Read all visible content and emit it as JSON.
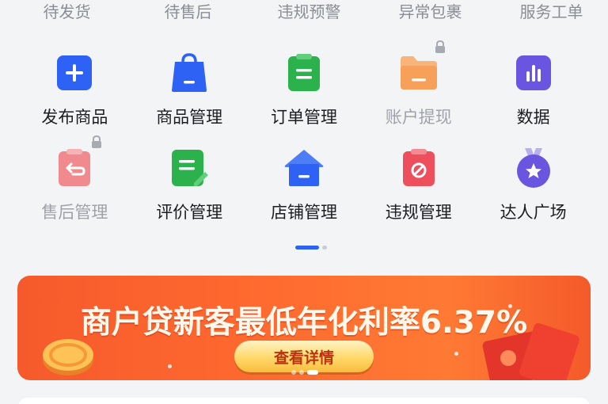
{
  "status_tabs": [
    {
      "label": "待发货"
    },
    {
      "label": "待售后"
    },
    {
      "label": "违规预警"
    },
    {
      "label": "异常包裹"
    },
    {
      "label": "服务工单"
    }
  ],
  "shortcuts_row1": [
    {
      "label": "发布商品",
      "icon": "add-square-icon",
      "color": "#2e62f5",
      "locked": false
    },
    {
      "label": "商品管理",
      "icon": "shopping-bag-icon",
      "color": "#2e62f5",
      "locked": false
    },
    {
      "label": "订单管理",
      "icon": "order-list-icon",
      "color": "#2bb24c",
      "locked": false
    },
    {
      "label": "账户提现",
      "icon": "wallet-folder-icon",
      "color": "#f6a05a",
      "locked": true
    },
    {
      "label": "数据",
      "icon": "bar-chart-icon",
      "color": "#6a55e0",
      "locked": false
    }
  ],
  "shortcuts_row2": [
    {
      "label": "售后管理",
      "icon": "return-clipboard-icon",
      "color": "#f08a8e",
      "locked": true
    },
    {
      "label": "评价管理",
      "icon": "review-note-icon",
      "color": "#2bb24c",
      "locked": false
    },
    {
      "label": "店铺管理",
      "icon": "store-house-icon",
      "color": "#2e62f5",
      "locked": false
    },
    {
      "label": "违规管理",
      "icon": "violation-clipboard-icon",
      "color": "#ee4f5c",
      "locked": false
    },
    {
      "label": "达人广场",
      "icon": "star-medal-icon",
      "color": "#6a55e0",
      "locked": false
    }
  ],
  "banner": {
    "title": "商户贷新客最低年化利率6.37%",
    "button_label": "查看详情"
  },
  "colors": {
    "accent": "#2e62f5",
    "banner_orange": "#ff6b2f"
  }
}
